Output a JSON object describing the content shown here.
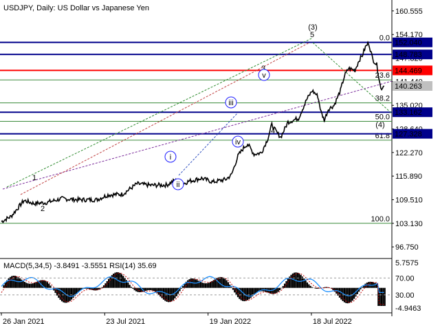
{
  "chart_data": {
    "type": "line",
    "title": "USDJPY, Daily:  US Dollar vs Japanese Yen",
    "y_ticks": [
      "160.555",
      "154.170",
      "147.820",
      "141.440",
      "135.020",
      "128.640",
      "122.270",
      "115.890",
      "109.510",
      "103.130",
      "96.750"
    ],
    "ylim": [
      93.8,
      163.5
    ],
    "x_ticks": [
      {
        "label": "26 Jan 2021",
        "idx": 0
      },
      {
        "label": "23 Jul 2021",
        "idx": 128
      },
      {
        "label": "19 Jan 2022",
        "idx": 256
      },
      {
        "label": "18 Jul 2022",
        "idx": 384
      }
    ],
    "price_anchors": [
      [
        0,
        103.6
      ],
      [
        12,
        105.0
      ],
      [
        28,
        109.3
      ],
      [
        40,
        108.5
      ],
      [
        55,
        108.7
      ],
      [
        75,
        109.8
      ],
      [
        95,
        109.5
      ],
      [
        118,
        109.5
      ],
      [
        132,
        110.8
      ],
      [
        150,
        111.0
      ],
      [
        168,
        113.8
      ],
      [
        185,
        113.4
      ],
      [
        205,
        113.5
      ],
      [
        215,
        114.8
      ],
      [
        222,
        113.5
      ],
      [
        232,
        114.5
      ],
      [
        248,
        115.3
      ],
      [
        262,
        114.3
      ],
      [
        278,
        115.0
      ],
      [
        285,
        116.2
      ],
      [
        293,
        121.3
      ],
      [
        300,
        123.5
      ],
      [
        305,
        124.6
      ],
      [
        313,
        121.8
      ],
      [
        322,
        122.2
      ],
      [
        330,
        126.0
      ],
      [
        335,
        129.8
      ],
      [
        340,
        128.0
      ],
      [
        346,
        126.4
      ],
      [
        355,
        130.5
      ],
      [
        368,
        131.5
      ],
      [
        378,
        136.5
      ],
      [
        385,
        139.0
      ],
      [
        392,
        137.5
      ],
      [
        396,
        133.2
      ],
      [
        400,
        131.0
      ],
      [
        405,
        134.0
      ],
      [
        412,
        135.0
      ],
      [
        420,
        139.0
      ],
      [
        425,
        143.0
      ],
      [
        430,
        145.0
      ],
      [
        438,
        144.5
      ],
      [
        443,
        147.2
      ],
      [
        447,
        148.5
      ],
      [
        451,
        150.8
      ],
      [
        455,
        151.9
      ],
      [
        460,
        147.5
      ],
      [
        465,
        146.0
      ],
      [
        470,
        139.5
      ],
      [
        474,
        140.3
      ]
    ],
    "price_levels": [
      {
        "label": "152.040",
        "value": 152.04,
        "color": "#00008b"
      },
      {
        "label": "148.783",
        "value": 148.783,
        "color": "#00008b"
      },
      {
        "label": "144.469",
        "value": 144.469,
        "color": "#ff0000"
      },
      {
        "label": "140.263",
        "value": 140.263,
        "color": "#c0c0c0"
      },
      {
        "label": "133.162",
        "value": 133.162,
        "color": "#00008b"
      },
      {
        "label": "127.328",
        "value": 127.328,
        "color": "#00008b"
      }
    ],
    "fibonacci": [
      {
        "label": "0.0",
        "value": 152.04
      },
      {
        "label": "23.6",
        "value": 141.9
      },
      {
        "label": "38.2",
        "value": 135.7
      },
      {
        "label": "50.0",
        "value": 130.7
      },
      {
        "label": "61.8",
        "value": 125.6
      },
      {
        "label": "100.0",
        "value": 103.13
      }
    ],
    "wave_labels": [
      {
        "text": "1",
        "color": "#8b1a1a"
      },
      {
        "text": "2",
        "color": "#8b1a1a"
      },
      {
        "text": "3",
        "color": "#8b1a1a"
      },
      {
        "text": "4",
        "color": "#8b1a1a"
      },
      {
        "text": "5",
        "color": "#8b1a1a"
      },
      {
        "text": "(3)",
        "color": "#2e8b2e"
      },
      {
        "text": "(4)",
        "color": "#2e8b2e"
      },
      {
        "text": "i",
        "color": "#1c1cff"
      },
      {
        "text": "ii",
        "color": "#1c1cff"
      },
      {
        "text": "iii",
        "color": "#1c1cff"
      },
      {
        "text": "iv",
        "color": "#1c1cff"
      },
      {
        "text": "v",
        "color": "#1c1cff"
      }
    ],
    "indicator": {
      "label": "MACD(5,34,5) -3.8491 -3.5551 RSI(14) 35.69",
      "ticks": [
        "5.7575",
        "70.00",
        "30.00",
        "-4.9463"
      ]
    }
  }
}
